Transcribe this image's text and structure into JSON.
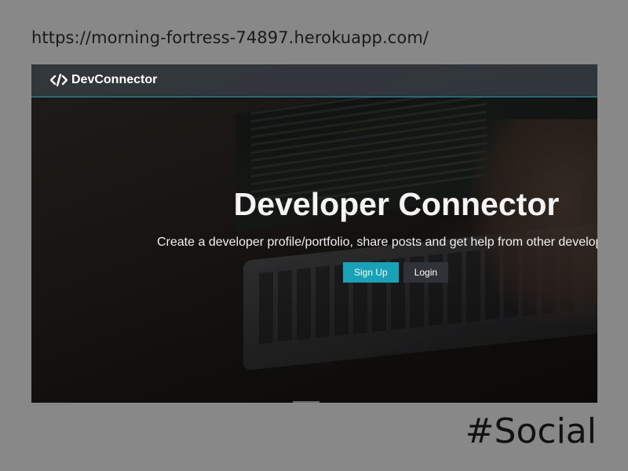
{
  "caption": {
    "url": "https://morning-fortress-74897.herokuapp.com/",
    "tag": "#Social"
  },
  "navbar": {
    "brand_icon": "code-icon",
    "brand_label": "DevConnector"
  },
  "landing": {
    "title": "Developer Connector",
    "lead": "Create a developer profile/portfolio, share posts and get help from other developers",
    "signup_label": "Sign Up",
    "login_label": "Login"
  },
  "colors": {
    "accent": "#17a2b8",
    "navbar": "#343a40",
    "page_background": "#888888"
  }
}
